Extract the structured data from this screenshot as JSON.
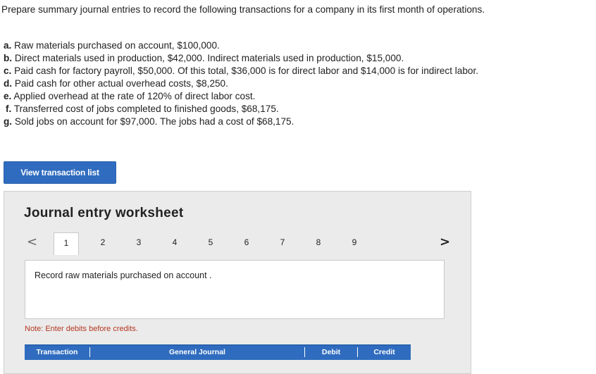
{
  "instructions": "Prepare summary journal entries to record the following transactions for a company in its first month of operations.",
  "transactions": [
    {
      "letter": "a.",
      "text": " Raw materials purchased on account, $100,000."
    },
    {
      "letter": "b.",
      "text": " Direct materials used in production, $42,000. Indirect materials used in production, $15,000."
    },
    {
      "letter": "c.",
      "text": " Paid cash for factory payroll, $50,000. Of this total, $36,000 is for direct labor and $14,000 is for indirect labor."
    },
    {
      "letter": "d.",
      "text": " Paid cash for other actual overhead costs, $8,250."
    },
    {
      "letter": "e.",
      "text": " Applied overhead at the rate of 120% of direct labor cost."
    },
    {
      "letter": "f.",
      "text": " Transferred cost of jobs completed to finished goods, $68,175."
    },
    {
      "letter": "g.",
      "text": " Sold jobs on account for $97,000. The jobs had a cost of $68,175."
    }
  ],
  "view_button": {
    "label": "View transaction list"
  },
  "worksheet": {
    "title": "Journal entry worksheet",
    "prev_arrow": "<",
    "next_arrow": ">",
    "pages": [
      "1",
      "2",
      "3",
      "4",
      "5",
      "6",
      "7",
      "8",
      "9"
    ],
    "active_page": "1",
    "prompt": "Record raw materials purchased on account .",
    "note": "Note: Enter debits before credits.",
    "table_headers": [
      "Transaction",
      "General Journal",
      "Debit",
      "Credit"
    ]
  },
  "colors": {
    "accent": "#2f6cbf",
    "note": "#b3361f",
    "panel": "#ebebeb"
  },
  "icons": {
    "prev": "chevron-left-icon",
    "next": "chevron-right-icon"
  }
}
